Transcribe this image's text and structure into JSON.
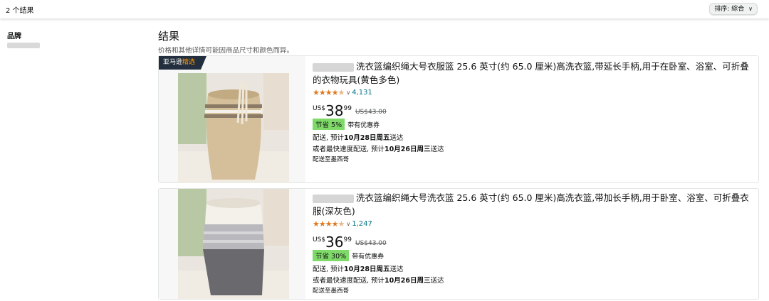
{
  "topbar": {
    "result_count": "2 个结果",
    "sort_label": "排序:",
    "sort_value": "綜合"
  },
  "sidebar": {
    "brand_title": "品牌"
  },
  "results": {
    "heading": "结果",
    "subtitle": "价格和其他详情可能因商品尺寸和颜色而异。"
  },
  "products": [
    {
      "badge_prefix": "亚马逊",
      "badge_accent": "精选",
      "title": "洗衣篮编织绳大号衣服篮 25.6 英寸(约 65.0 厘米)高洗衣篮,带延长手柄,用于在卧室、浴室、可折叠的衣物玩具(黄色多色)",
      "rating": "4.5",
      "review_count": "4,131",
      "currency": "US$",
      "price_whole": "38",
      "price_fraction": "99",
      "list_price": "US$43.00",
      "coupon": "节省 5%",
      "coupon_note": "带有优惠券",
      "delivery_prefix": "配送, 预计",
      "delivery_date": "10月28日周五",
      "delivery_suffix": "送达",
      "fast_prefix": "或者最快速度配送, 预计",
      "fast_date": "10月26日周三",
      "fast_suffix": "送达",
      "ship_to": "配送至墨西哥"
    },
    {
      "title": "洗衣篮编织绳大号洗衣篮 25.6 英寸(约 65.0 厘米)高洗衣篮,带加长手柄,用于卧室、浴室、可折叠衣服(深灰色)",
      "rating": "4.5",
      "review_count": "1,247",
      "currency": "US$",
      "price_whole": "36",
      "price_fraction": "99",
      "list_price": "US$43.00",
      "coupon": "节省 30%",
      "coupon_note": "带有优惠券",
      "delivery_prefix": "配送, 预计",
      "delivery_date": "10月28日周五",
      "delivery_suffix": "送达",
      "fast_prefix": "或者最快速度配送, 预计",
      "fast_date": "10月26日周三",
      "fast_suffix": "送达",
      "ship_to": "配送至墨西哥"
    }
  ],
  "colors": {
    "star": "#de7921",
    "link": "#007185",
    "coupon": "#7fda69",
    "badge_bg": "#232f3e"
  }
}
